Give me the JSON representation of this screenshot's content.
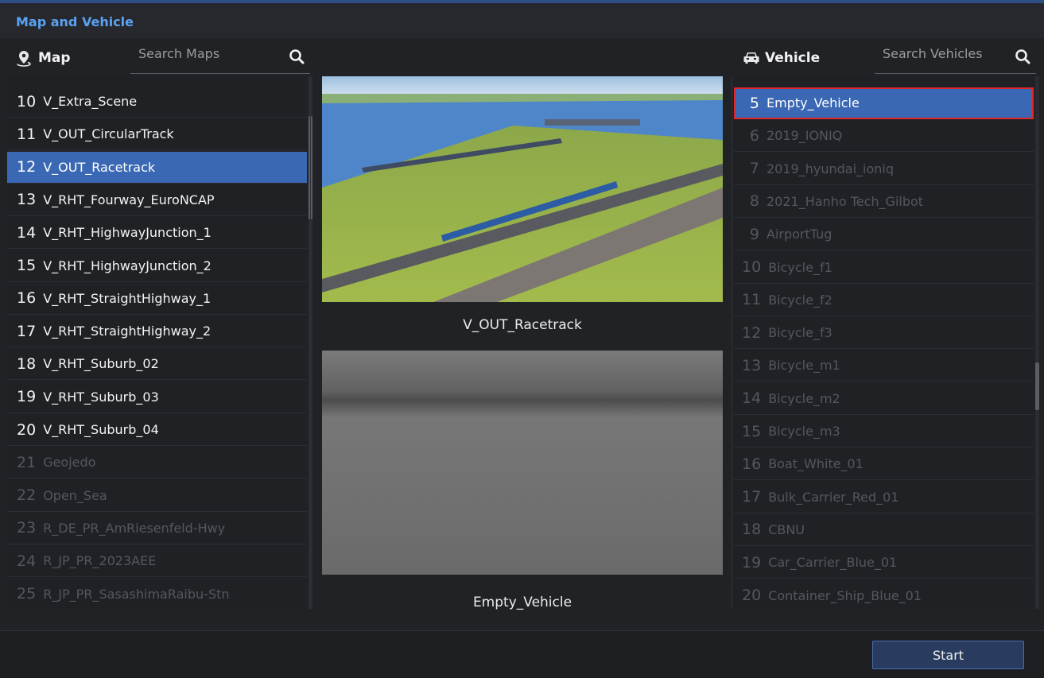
{
  "window": {
    "title": "Map and Vehicle"
  },
  "map_panel": {
    "header": "Map",
    "header_icon": "map-pin-icon",
    "search_placeholder": "Search Maps",
    "items": [
      {
        "num": "10",
        "name": "V_Extra_Scene",
        "state": "on"
      },
      {
        "num": "11",
        "name": "V_OUT_CircularTrack",
        "state": "on"
      },
      {
        "num": "12",
        "name": "V_OUT_Racetrack",
        "state": "selected"
      },
      {
        "num": "13",
        "name": "V_RHT_Fourway_EuroNCAP",
        "state": "on"
      },
      {
        "num": "14",
        "name": "V_RHT_HighwayJunction_1",
        "state": "on"
      },
      {
        "num": "15",
        "name": "V_RHT_HighwayJunction_2",
        "state": "on"
      },
      {
        "num": "16",
        "name": "V_RHT_StraightHighway_1",
        "state": "on"
      },
      {
        "num": "17",
        "name": "V_RHT_StraightHighway_2",
        "state": "on"
      },
      {
        "num": "18",
        "name": "V_RHT_Suburb_02",
        "state": "on"
      },
      {
        "num": "19",
        "name": "V_RHT_Suburb_03",
        "state": "on"
      },
      {
        "num": "20",
        "name": "V_RHT_Suburb_04",
        "state": "on"
      },
      {
        "num": "21",
        "name": "Geojedo",
        "state": "off"
      },
      {
        "num": "22",
        "name": "Open_Sea",
        "state": "off"
      },
      {
        "num": "23",
        "name": "R_DE_PR_AmRiesenfeld-Hwy",
        "state": "off"
      },
      {
        "num": "24",
        "name": "R_JP_PR_2023AEE",
        "state": "off"
      },
      {
        "num": "25",
        "name": "R_JP_PR_SasashimaRaibu-Stn",
        "state": "off"
      }
    ]
  },
  "preview": {
    "map_caption": "V_OUT_Racetrack",
    "vehicle_caption": "Empty_Vehicle"
  },
  "vehicle_panel": {
    "header": "Vehicle",
    "header_icon": "car-icon",
    "search_placeholder": "Search Vehicles",
    "items": [
      {
        "num": "5",
        "name": "Empty_Vehicle",
        "state": "selected"
      },
      {
        "num": "6",
        "name": "2019_IONIQ",
        "state": "off"
      },
      {
        "num": "7",
        "name": "2019_hyundai_ioniq",
        "state": "off"
      },
      {
        "num": "8",
        "name": "2021_Hanho Tech_Gilbot",
        "state": "off"
      },
      {
        "num": "9",
        "name": "AirportTug",
        "state": "off"
      },
      {
        "num": "10",
        "name": "Bicycle_f1",
        "state": "off"
      },
      {
        "num": "11",
        "name": "Bicycle_f2",
        "state": "off"
      },
      {
        "num": "12",
        "name": "Bicycle_f3",
        "state": "off"
      },
      {
        "num": "13",
        "name": "Bicycle_m1",
        "state": "off"
      },
      {
        "num": "14",
        "name": "Bicycle_m2",
        "state": "off"
      },
      {
        "num": "15",
        "name": "Bicycle_m3",
        "state": "off"
      },
      {
        "num": "16",
        "name": "Boat_White_01",
        "state": "off"
      },
      {
        "num": "17",
        "name": "Bulk_Carrier_Red_01",
        "state": "off"
      },
      {
        "num": "18",
        "name": "CBNU",
        "state": "off"
      },
      {
        "num": "19",
        "name": "Car_Carrier_Blue_01",
        "state": "off"
      },
      {
        "num": "20",
        "name": "Container_Ship_Blue_01",
        "state": "off"
      }
    ]
  },
  "footer": {
    "start_label": "Start"
  },
  "colors": {
    "accent": "#3a68b4",
    "title": "#5aa2f2",
    "highlight_outline": "#e0262b"
  }
}
